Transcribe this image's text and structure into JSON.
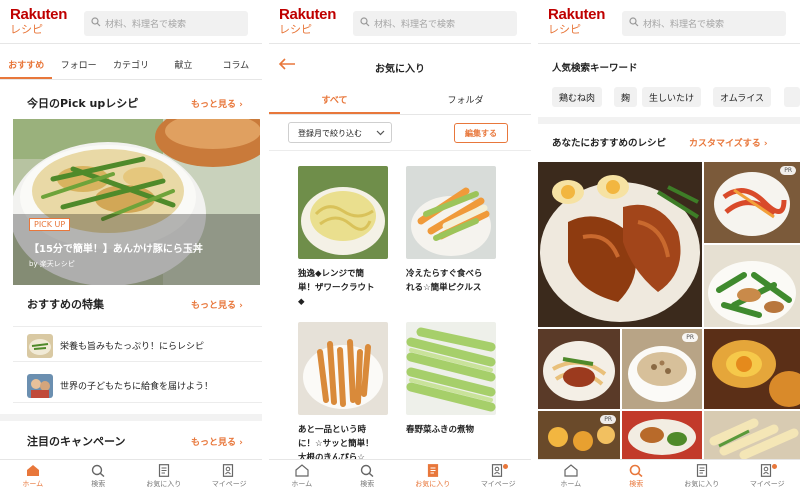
{
  "header": {
    "logo_top": "Rakuten",
    "logo_bottom": "レシピ",
    "search_placeholder": "材料、料理名で検索"
  },
  "screen1": {
    "tabs": [
      "おすすめ",
      "フォロー",
      "カテゴリ",
      "献立",
      "コラム"
    ],
    "active_tab": 0,
    "pickup_title": "今日のPick upレシピ",
    "pickup_more": "もっと見る",
    "pickup_badge": "PICK UP",
    "pickup_recipe": "【15分で簡単！】あんかけ豚にら玉丼",
    "pickup_by": "by 楽天レシピ",
    "feature_title": "おすすめの特集",
    "feature_more": "もっと見る",
    "features": [
      "栄養も旨みもたっぷり！にらレシピ",
      "世界の子どもたちに給食を届けよう！"
    ],
    "campaign_title": "注目のキャンペーン",
    "campaign_more": "もっと見る"
  },
  "screen2": {
    "title": "お気に入り",
    "tabs": [
      "すべて",
      "フォルダ"
    ],
    "filter_label": "登録月で絞り込む",
    "edit_label": "編集する",
    "cards": [
      {
        "line1": "独逸◆レンジで簡",
        "line2": "単！ザワークラウト",
        "line3": "◆"
      },
      {
        "line1": "冷えたらすぐ食べら",
        "line2": "れる☆簡単ピクルス",
        "line3": ""
      },
      {
        "line1": "あと一品という時",
        "line2": "に！☆サッと簡単！",
        "line3": "大根のきんぴら☆"
      },
      {
        "line1": "春野菜ふきの煮物",
        "line2": "",
        "line3": ""
      }
    ]
  },
  "screen3": {
    "keyword_title": "人気検索キーワード",
    "keywords": [
      "鶏むね肉",
      "麹",
      "生しいたけ",
      "オムライス"
    ],
    "recommend_title": "あなたにおすすめのレシピ",
    "recommend_more": "カスタマイズする",
    "pr_label": "PR"
  },
  "bottom_nav": [
    "ホーム",
    "検索",
    "お気に入り",
    "マイページ"
  ],
  "colors": {
    "accent": "#e8773b",
    "brand_red": "#bf0000"
  }
}
